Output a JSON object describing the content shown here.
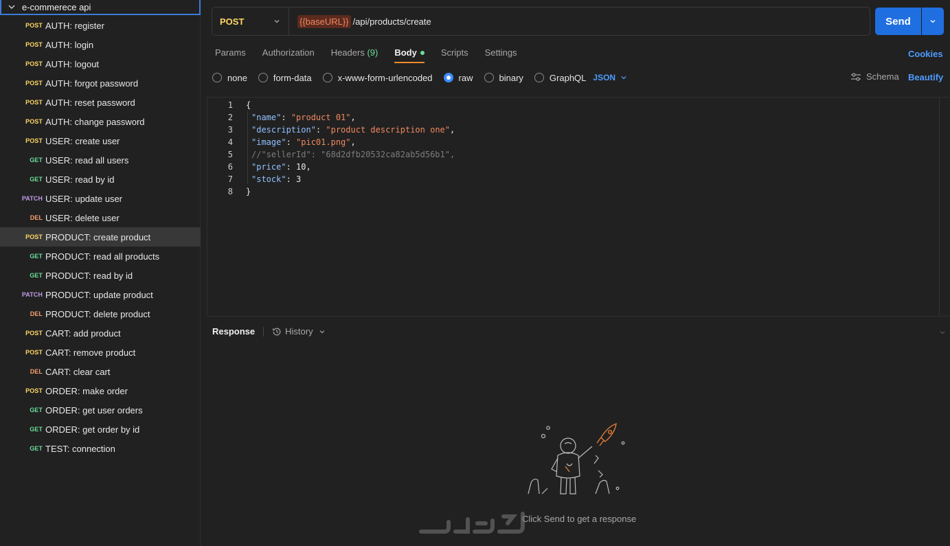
{
  "sidebar": {
    "collection_name": "e-commerece api",
    "requests": [
      {
        "method": "POST",
        "label": "AUTH: register"
      },
      {
        "method": "POST",
        "label": "AUTH: login"
      },
      {
        "method": "POST",
        "label": "AUTH: logout"
      },
      {
        "method": "POST",
        "label": "AUTH: forgot password"
      },
      {
        "method": "POST",
        "label": "AUTH: reset password"
      },
      {
        "method": "POST",
        "label": "AUTH: change password"
      },
      {
        "method": "POST",
        "label": "USER: create user"
      },
      {
        "method": "GET",
        "label": "USER: read all users"
      },
      {
        "method": "GET",
        "label": "USER: read by id"
      },
      {
        "method": "PATCH",
        "label": "USER: update user"
      },
      {
        "method": "DEL",
        "label": "USER: delete user"
      },
      {
        "method": "POST",
        "label": "PRODUCT: create product",
        "active": true
      },
      {
        "method": "GET",
        "label": "PRODUCT: read all products"
      },
      {
        "method": "GET",
        "label": "PRODUCT: read by id"
      },
      {
        "method": "PATCH",
        "label": "PRODUCT: update product"
      },
      {
        "method": "DEL",
        "label": "PRODUCT: delete product"
      },
      {
        "method": "POST",
        "label": "CART: add product"
      },
      {
        "method": "POST",
        "label": "CART: remove product"
      },
      {
        "method": "DEL",
        "label": "CART: clear cart"
      },
      {
        "method": "POST",
        "label": "ORDER: make order"
      },
      {
        "method": "GET",
        "label": "ORDER: get user orders"
      },
      {
        "method": "GET",
        "label": "ORDER: get order by id"
      },
      {
        "method": "GET",
        "label": "TEST: connection"
      }
    ]
  },
  "request": {
    "method": "POST",
    "url_variable": "{{baseURL}}",
    "url_path": "/api/products/create",
    "send_label": "Send"
  },
  "tabs": {
    "params": "Params",
    "authorization": "Authorization",
    "headers": "Headers",
    "headers_count": "(9)",
    "body": "Body",
    "scripts": "Scripts",
    "settings": "Settings",
    "cookies": "Cookies"
  },
  "body_types": {
    "none": "none",
    "form_data": "form-data",
    "urlencoded": "x-www-form-urlencoded",
    "raw": "raw",
    "binary": "binary",
    "graphql": "GraphQL",
    "format": "JSON",
    "schema": "Schema",
    "beautify": "Beautify"
  },
  "editor": {
    "lines": [
      {
        "n": "1",
        "tokens": [
          [
            "p",
            "{"
          ]
        ]
      },
      {
        "n": "2",
        "tokens": [
          [
            "k",
            "\"name\""
          ],
          [
            "p",
            ": "
          ],
          [
            "s",
            "\"product 01\""
          ],
          [
            "p",
            ","
          ]
        ]
      },
      {
        "n": "3",
        "tokens": [
          [
            "k",
            "\"description\""
          ],
          [
            "p",
            ": "
          ],
          [
            "s",
            "\"product description one\""
          ],
          [
            "p",
            ","
          ]
        ]
      },
      {
        "n": "4",
        "tokens": [
          [
            "k",
            "\"image\""
          ],
          [
            "p",
            ": "
          ],
          [
            "s",
            "\"pic01.png\""
          ],
          [
            "p",
            ","
          ]
        ]
      },
      {
        "n": "5",
        "tokens": [
          [
            "c",
            "//\"sellerId\": \"68d2dfb20532ca82ab5d56b1\","
          ]
        ]
      },
      {
        "n": "6",
        "tokens": [
          [
            "k",
            "\"price\""
          ],
          [
            "p",
            ": "
          ],
          [
            "n",
            "10"
          ],
          [
            "p",
            ","
          ]
        ]
      },
      {
        "n": "7",
        "tokens": [
          [
            "k",
            "\"stock\""
          ],
          [
            "p",
            ": "
          ],
          [
            "n",
            "3"
          ]
        ]
      },
      {
        "n": "8",
        "tokens": [
          [
            "p",
            "}"
          ]
        ]
      }
    ]
  },
  "response": {
    "title": "Response",
    "history": "History",
    "empty_message": "Click Send to get a response",
    "watermark_text": "خمسات"
  },
  "colors": {
    "accent_blue": "#1f6fe0",
    "post": "#ffd666",
    "get": "#6bdd9a",
    "patch": "#c09be8",
    "del": "#f5a06b",
    "active_tab_underline": "#f08a2e"
  }
}
